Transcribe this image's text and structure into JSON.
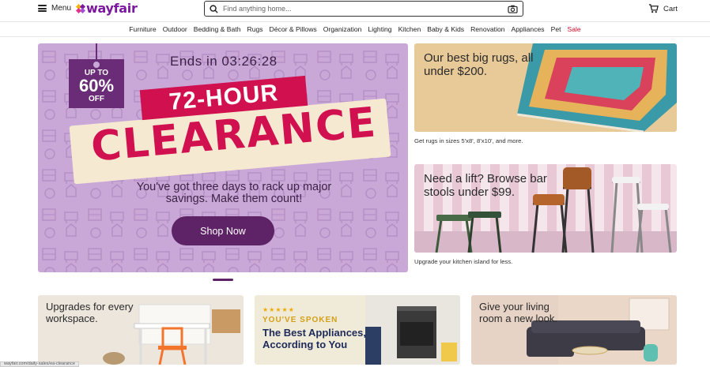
{
  "header": {
    "menu_label": "Menu",
    "logo_text": "wayfair",
    "search_placeholder": "Find anything home...",
    "cart_label": "Cart"
  },
  "nav": {
    "items": [
      "Furniture",
      "Outdoor",
      "Bedding & Bath",
      "Rugs",
      "Décor & Pillows",
      "Organization",
      "Lighting",
      "Kitchen",
      "Baby & Kids",
      "Renovation",
      "Appliances",
      "Pet",
      "Sale"
    ]
  },
  "hero": {
    "tag_line1": "UP TO",
    "tag_line2": "60%",
    "tag_line3": "OFF",
    "countdown": "Ends in 03:26:28",
    "ribbon": "72-HOUR",
    "headline": "CLEARANCE",
    "subtext": "You've got three days to rack up major savings. Make them count!",
    "cta": "Shop Now"
  },
  "promo_rugs": {
    "title": "Our best big rugs, all under $200.",
    "caption": "Get rugs in sizes 5'x8', 8'x10', and more."
  },
  "promo_stools": {
    "title": "Need a lift? Browse bar stools under $99.",
    "caption": "Upgrade your kitchen island for less."
  },
  "bottom": {
    "workspace_title": "Upgrades for every workspace.",
    "appliances_stars": "★★★★★",
    "appliances_kicker": "YOU'VE SPOKEN",
    "appliances_title": "The Best Appliances, According to You",
    "living_title": "Give your living room a new look."
  },
  "status_url": "wayfair.com/daily-sales/ea-clearance",
  "colors": {
    "brand": "#7b189f",
    "sale": "#c8102e",
    "hero_bg": "#c9a8d8",
    "cta": "#5e2266",
    "clearance": "#d0104f"
  }
}
